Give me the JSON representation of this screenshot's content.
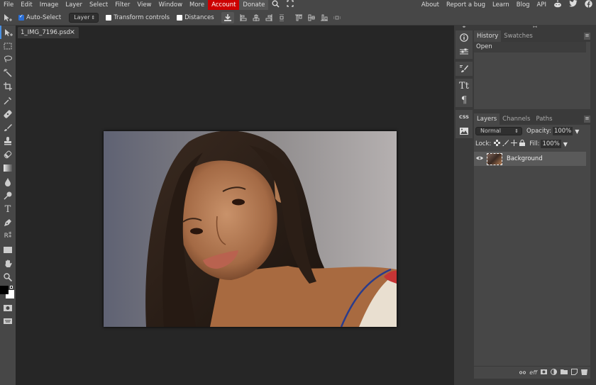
{
  "menubar": {
    "items": [
      "File",
      "Edit",
      "Image",
      "Layer",
      "Select",
      "Filter",
      "View",
      "Window",
      "More",
      "Account",
      "Donate"
    ],
    "right_links": [
      "About",
      "Report a bug",
      "Learn",
      "Blog",
      "API"
    ],
    "icons": [
      "search-icon",
      "fullscreen-icon",
      "reddit-icon",
      "twitter-icon",
      "facebook-icon"
    ]
  },
  "options": {
    "auto_select_label": "Auto-Select",
    "auto_select_checked": true,
    "target_select": "Layer",
    "transform_controls_label": "Transform controls",
    "transform_checked": false,
    "distances_label": "Distances",
    "distances_checked": false
  },
  "tools": [
    "move",
    "marquee",
    "lasso",
    "magic-wand",
    "crop",
    "eyedropper",
    "healing",
    "brush",
    "clone-stamp",
    "eraser",
    "gradient",
    "blur",
    "dodge",
    "type",
    "pen",
    "path-select",
    "rectangle",
    "hand",
    "zoom"
  ],
  "document_tab": {
    "name": "1_IMG_7196.psd",
    "close": "×"
  },
  "history_panel": {
    "tabs": [
      "History",
      "Swatches"
    ],
    "active_tab": "History",
    "entries": [
      "Open"
    ]
  },
  "layers_panel": {
    "tabs": [
      "Layers",
      "Channels",
      "Paths"
    ],
    "active_tab": "Layers",
    "blend_mode": "Normal",
    "opacity_label": "Opacity:",
    "opacity": "100%",
    "lock_label": "Lock:",
    "fill_label": "Fill:",
    "fill": "100%",
    "layers": [
      {
        "name": "Background",
        "visible": true
      }
    ]
  },
  "side_icons": [
    "info-icon",
    "properties-icon",
    "brush-settings-icon",
    "character-icon",
    "paragraph-icon",
    "css-icon",
    "image-icon"
  ],
  "footer_icons": [
    "link-icon",
    "effects-icon",
    "mask-icon",
    "adjustment-icon",
    "folder-icon",
    "new-layer-icon",
    "delete-icon"
  ]
}
